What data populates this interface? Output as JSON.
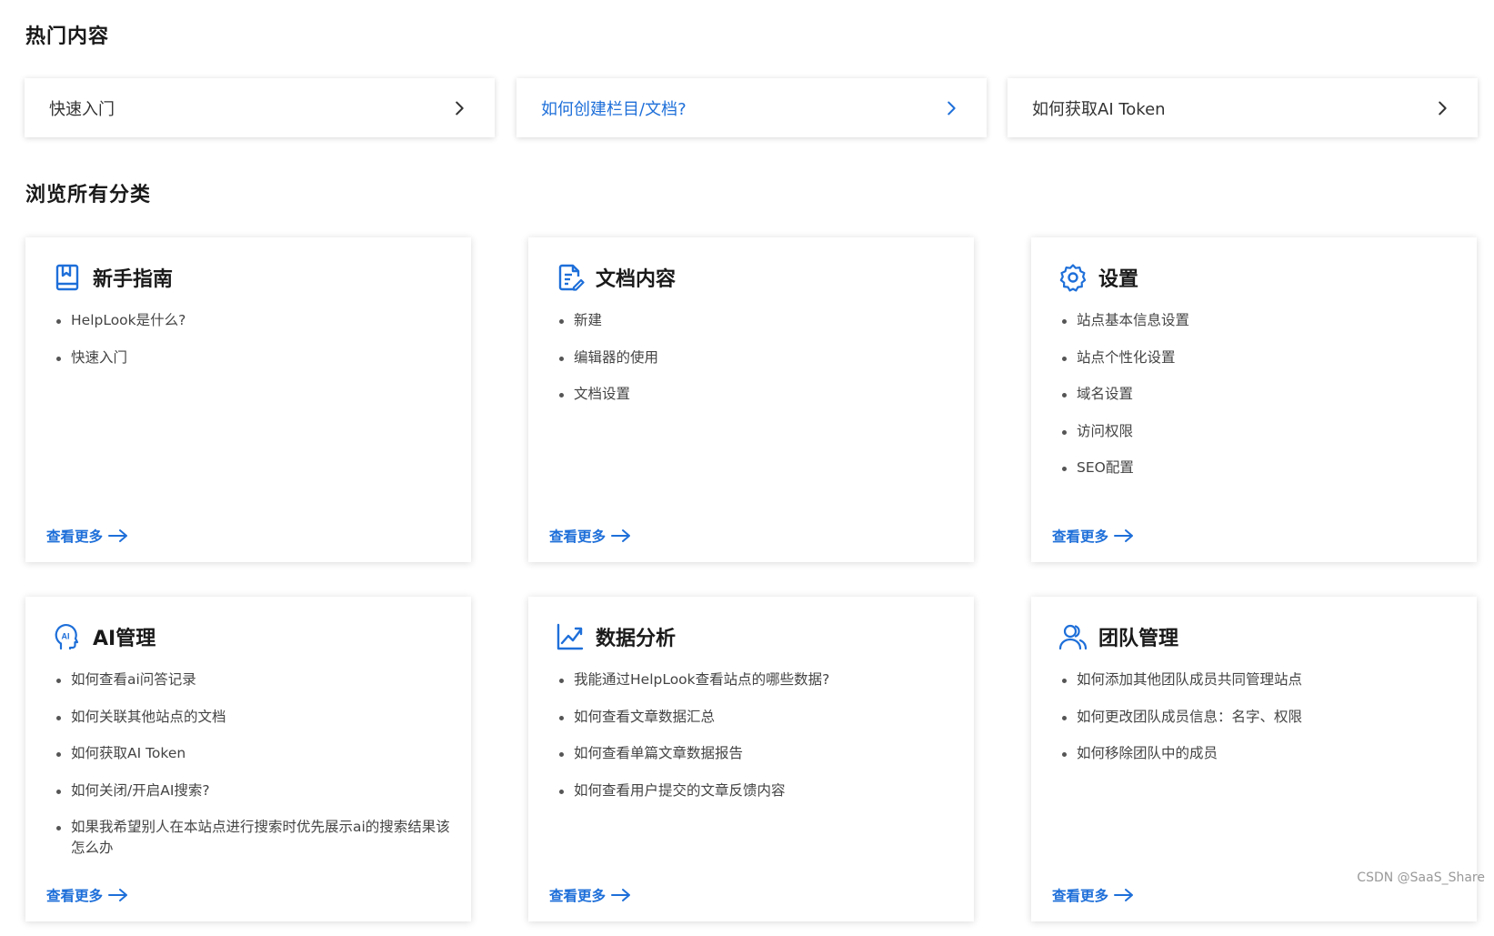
{
  "sections": {
    "hot_title": "热门内容",
    "browse_title": "浏览所有分类"
  },
  "hot_items": [
    {
      "label": "快速入门",
      "icon": "chevron-right-icon"
    },
    {
      "label": "如何创建栏目/文档?",
      "icon": "chevron-right-icon",
      "active": true
    },
    {
      "label": "如何获取AI Token",
      "icon": "chevron-right-icon"
    }
  ],
  "categories": [
    {
      "title": "新手指南",
      "icon": "book-icon",
      "items": [
        "HelpLook是什么?",
        "快速入门"
      ],
      "more": "查看更多"
    },
    {
      "title": "文档内容",
      "icon": "document-edit-icon",
      "items": [
        "新建",
        "编辑器的使用",
        "文档设置"
      ],
      "more": "查看更多"
    },
    {
      "title": "设置",
      "icon": "gear-icon",
      "items": [
        "站点基本信息设置",
        "站点个性化设置",
        "域名设置",
        "访问权限",
        "SEO配置"
      ],
      "more": "查看更多"
    },
    {
      "title": "AI管理",
      "icon": "ai-head-icon",
      "items": [
        "如何查看ai问答记录",
        "如何关联其他站点的文档",
        "如何获取AI Token",
        "如何关闭/开启AI搜索?",
        "如果我希望别人在本站点进行搜索时优先展示ai的搜索结果该怎么办"
      ],
      "more": "查看更多"
    },
    {
      "title": "数据分析",
      "icon": "chart-trend-icon",
      "items": [
        "我能通过HelpLook查看站点的哪些数据?",
        "如何查看文章数据汇总",
        "如何查看单篇文章数据报告",
        "如何查看用户提交的文章反馈内容"
      ],
      "more": "查看更多"
    },
    {
      "title": "团队管理",
      "icon": "team-users-icon",
      "items": [
        "如何添加其他团队成员共同管理站点",
        "如何更改团队成员信息：名字、权限",
        "如何移除团队中的成员"
      ],
      "more": "查看更多"
    }
  ],
  "watermark": "CSDN @SaaS_Share",
  "colors": {
    "accent": "#1e6fd9",
    "text": "#333333",
    "bullet": "#555555"
  }
}
